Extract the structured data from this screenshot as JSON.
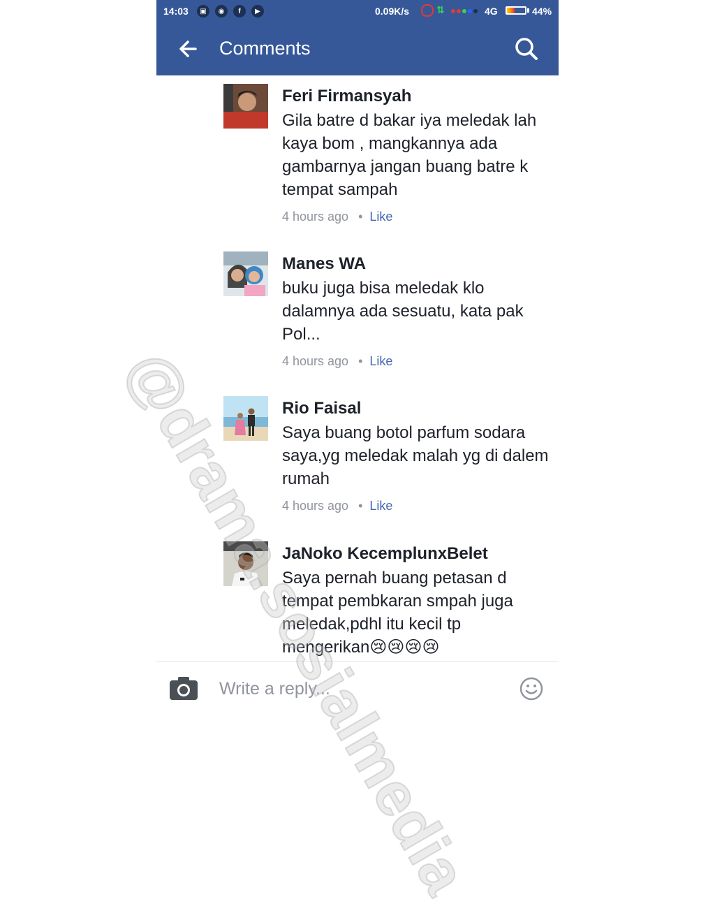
{
  "status_bar": {
    "time": "14:03",
    "net_speed": "0.09K/s",
    "network": "4G",
    "battery": "44%",
    "battery_level": 0.44
  },
  "app_bar": {
    "title": "Comments"
  },
  "comments": [
    {
      "name": "Feri Firmansyah",
      "text": "Gila batre d bakar iya meledak lah kaya bom  , mangkannya ada gambarnya  jangan buang batre k tempat sampah",
      "time": "4 hours ago",
      "separator": "•",
      "like": "Like"
    },
    {
      "name": "Manes WA",
      "text": "buku juga bisa meledak klo dalamnya ada sesuatu, kata pak Pol...",
      "time": "4 hours ago",
      "separator": "•",
      "like": "Like"
    },
    {
      "name": "Rio Faisal",
      "text": "Saya buang botol parfum sodara saya,yg meledak malah yg di dalem rumah",
      "time": "4 hours ago",
      "separator": "•",
      "like": "Like"
    },
    {
      "name": "JaNoko KecemplunxBelet",
      "text": "Saya pernah buang petasan d tempat pembkaran smpah juga meledak,pdhl itu kecil tp mengerikan😢😢😢😢"
    }
  ],
  "reply": {
    "placeholder": "Write a reply..."
  },
  "watermark": "@drama.sosialmedia",
  "colors": {
    "brand": "#365899",
    "like": "#4267b2",
    "meta": "#90949c",
    "text": "#1d2129"
  }
}
